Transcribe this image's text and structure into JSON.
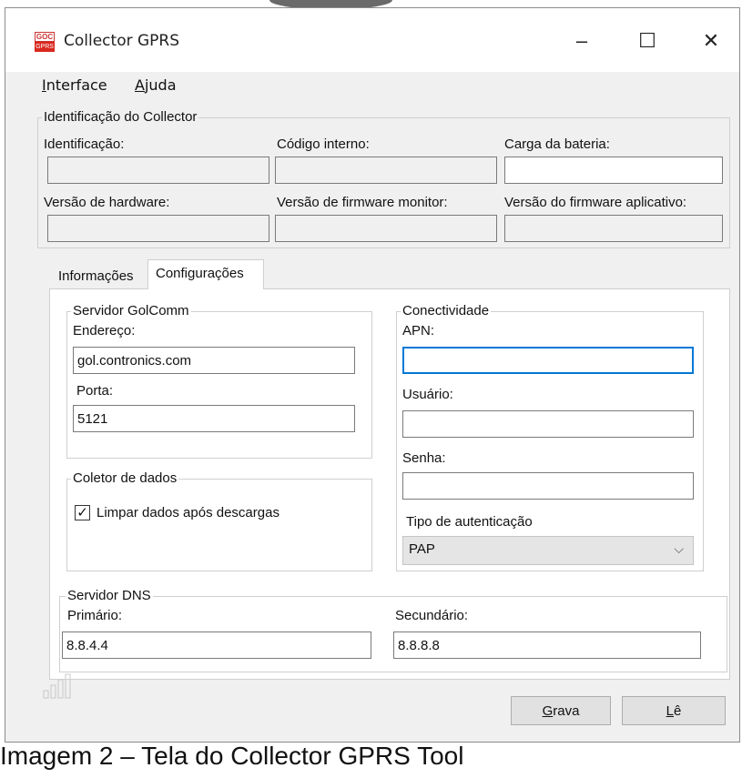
{
  "window": {
    "title": "Collector GPRS",
    "icon_top": "GOC",
    "icon_bottom": "GPRS",
    "minimize": "–",
    "maximize": "☐",
    "close": "✕"
  },
  "menu": {
    "interface_first": "I",
    "interface_rest": "nterface",
    "help_first": "A",
    "help_rest": "juda"
  },
  "identification": {
    "legend": "Identificação do Collector",
    "fields": [
      {
        "label": "Identificação:",
        "value": ""
      },
      {
        "label": "Código interno:",
        "value": ""
      },
      {
        "label": "Carga da bateria:",
        "value": ""
      },
      {
        "label": "Versão de hardware:",
        "value": ""
      },
      {
        "label": "Versão de firmware monitor:",
        "value": ""
      },
      {
        "label": "Versão do firmware aplicativo:",
        "value": ""
      }
    ]
  },
  "tabs": {
    "info": "Informações",
    "config": "Configurações",
    "active": "Configurações"
  },
  "golcomm": {
    "legend": "Servidor GolComm",
    "address_label": "Endereço:",
    "address_value": "gol.contronics.com",
    "port_label": "Porta:",
    "port_value": "5121"
  },
  "collector": {
    "legend": "Coletor de dados",
    "checkbox_label": "Limpar dados após descargas",
    "checked": true,
    "checkmark": "✓"
  },
  "connectivity": {
    "legend": "Conectividade",
    "apn_label": "APN:",
    "apn_value": "",
    "user_label": "Usuário:",
    "user_value": "",
    "password_label": "Senha:",
    "password_value": "",
    "auth_label": "Tipo de autenticação",
    "auth_value": "PAP",
    "chevron": "⌵"
  },
  "dns": {
    "legend": "Servidor DNS",
    "primary_label": "Primário:",
    "primary_value": "8.8.4.4",
    "secondary_label": "Secundário:",
    "secondary_value": "8.8.8.8"
  },
  "buttons": {
    "save_first": "G",
    "save_rest": "rava",
    "read_first": "L",
    "read_rest": "ê"
  },
  "caption": "Imagem 2 – Tela do Collector GPRS Tool",
  "colors": {
    "window_bg": "#f0f0f0",
    "focus_border": "#0078d7",
    "icon_red": "#d9281f"
  }
}
